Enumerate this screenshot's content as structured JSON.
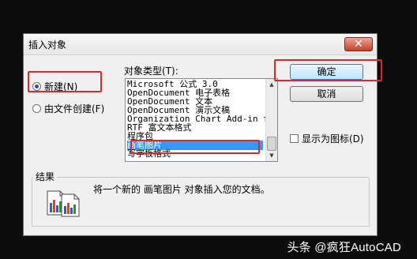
{
  "dialog": {
    "title": "插入对象",
    "close_glyph": "✕",
    "options": {
      "create_new": "新建(N)",
      "create_from_file": "由文件创建(F)",
      "selected": "create_new"
    },
    "object_type_label": "对象类型(T):",
    "object_types": [
      "Microsoft 公式 3.0",
      "OpenDocument 电子表格",
      "OpenDocument 文本",
      "OpenDocument 演示文稿",
      "Organization Chart Add-in for",
      "RTF 富文本格式",
      "程序包",
      "画笔图片",
      "写字板格式"
    ],
    "selected_object_type": "画笔图片",
    "buttons": {
      "ok": "确定",
      "cancel": "取消"
    },
    "display_as_icon": {
      "label": "显示为图标(D)",
      "checked": false
    },
    "result": {
      "title": "结果",
      "text": "将一个新的 画笔图片 对象插入您的文档。"
    }
  },
  "watermark": "头条 @疯狂AutoCAD",
  "colors": {
    "highlight_red": "#e0252b",
    "selection_blue": "#3399ff",
    "background": "#0c0c0c",
    "dialog_face": "#f0f0f0"
  },
  "icons": {
    "close": "close-icon",
    "result": "document-insert-icon",
    "scroll_up": "scroll-up-arrow-icon",
    "scroll_down": "scroll-down-arrow-icon"
  }
}
